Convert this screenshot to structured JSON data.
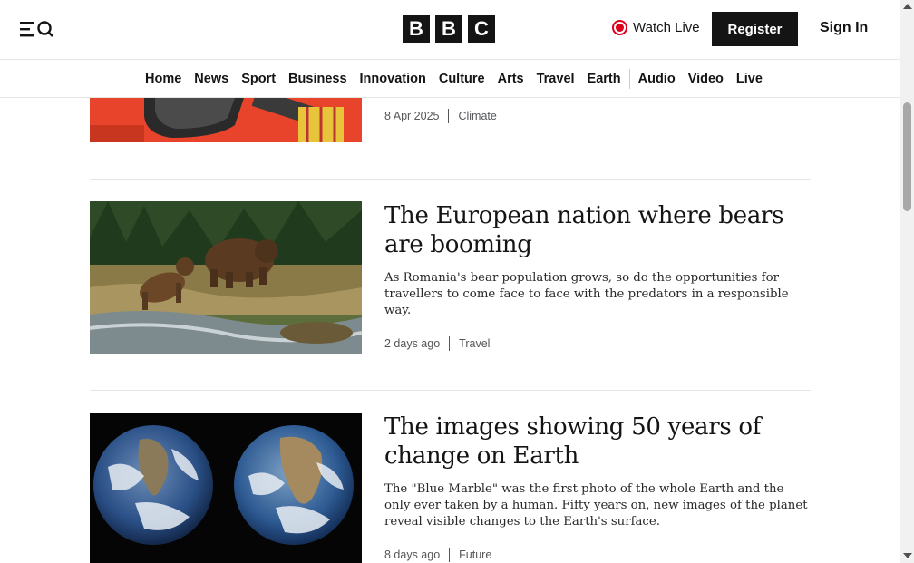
{
  "header": {
    "logo_letters": [
      "B",
      "B",
      "C"
    ],
    "watch_live_label": "Watch Live",
    "register_label": "Register",
    "signin_label": "Sign In",
    "menu_icon": "menu-search-icon",
    "live_icon": "live-dot-icon"
  },
  "nav": {
    "items_primary": [
      "Home",
      "News",
      "Sport",
      "Business",
      "Innovation",
      "Culture",
      "Arts",
      "Travel",
      "Earth"
    ],
    "items_secondary": [
      "Audio",
      "Video",
      "Live"
    ]
  },
  "stories": [
    {
      "headline": "",
      "summary": "",
      "date": "8 Apr 2025",
      "section": "Climate"
    },
    {
      "headline": "The European nation where bears are booming",
      "summary": "As Romania's bear population grows, so do the opportunities for travellers to come face to face with the predators in a responsible way.",
      "date": "2 days ago",
      "section": "Travel"
    },
    {
      "headline": "The images showing 50 years of change on Earth",
      "summary": "The \"Blue Marble\" was the first photo of the whole Earth and the only ever taken by a human. Fifty years on, new images of the planet reveal visible changes to the Earth's surface.",
      "date": "8 days ago",
      "section": "Future"
    }
  ],
  "colors": {
    "brand_black": "#141414",
    "live_red": "#e0001b",
    "divider": "#e6e6e6",
    "meta_grey": "#545658"
  }
}
